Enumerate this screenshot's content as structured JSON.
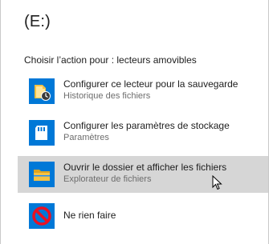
{
  "dialog": {
    "title": "(E:)",
    "prompt": "Choisir l’action pour : lecteurs amovibles"
  },
  "options": [
    {
      "label": "Configurer ce lecteur pour la sauvegarde",
      "sublabel": "Historique des fichiers",
      "icon": "file-history-icon",
      "selected": false
    },
    {
      "label": "Configurer les paramètres de stockage",
      "sublabel": "Paramètres",
      "icon": "sd-card-icon",
      "selected": false
    },
    {
      "label": "Ouvrir le dossier et afficher les fichiers",
      "sublabel": "Explorateur de fichiers",
      "icon": "folder-icon",
      "selected": true
    },
    {
      "label": "Ne rien faire",
      "sublabel": "",
      "icon": "no-action-icon",
      "selected": false
    }
  ],
  "colors": {
    "tile_blue": "#0078d7",
    "folder_yellow": "#f6c244",
    "no_red": "#e81123",
    "selected_bg": "#d6d6d6"
  }
}
